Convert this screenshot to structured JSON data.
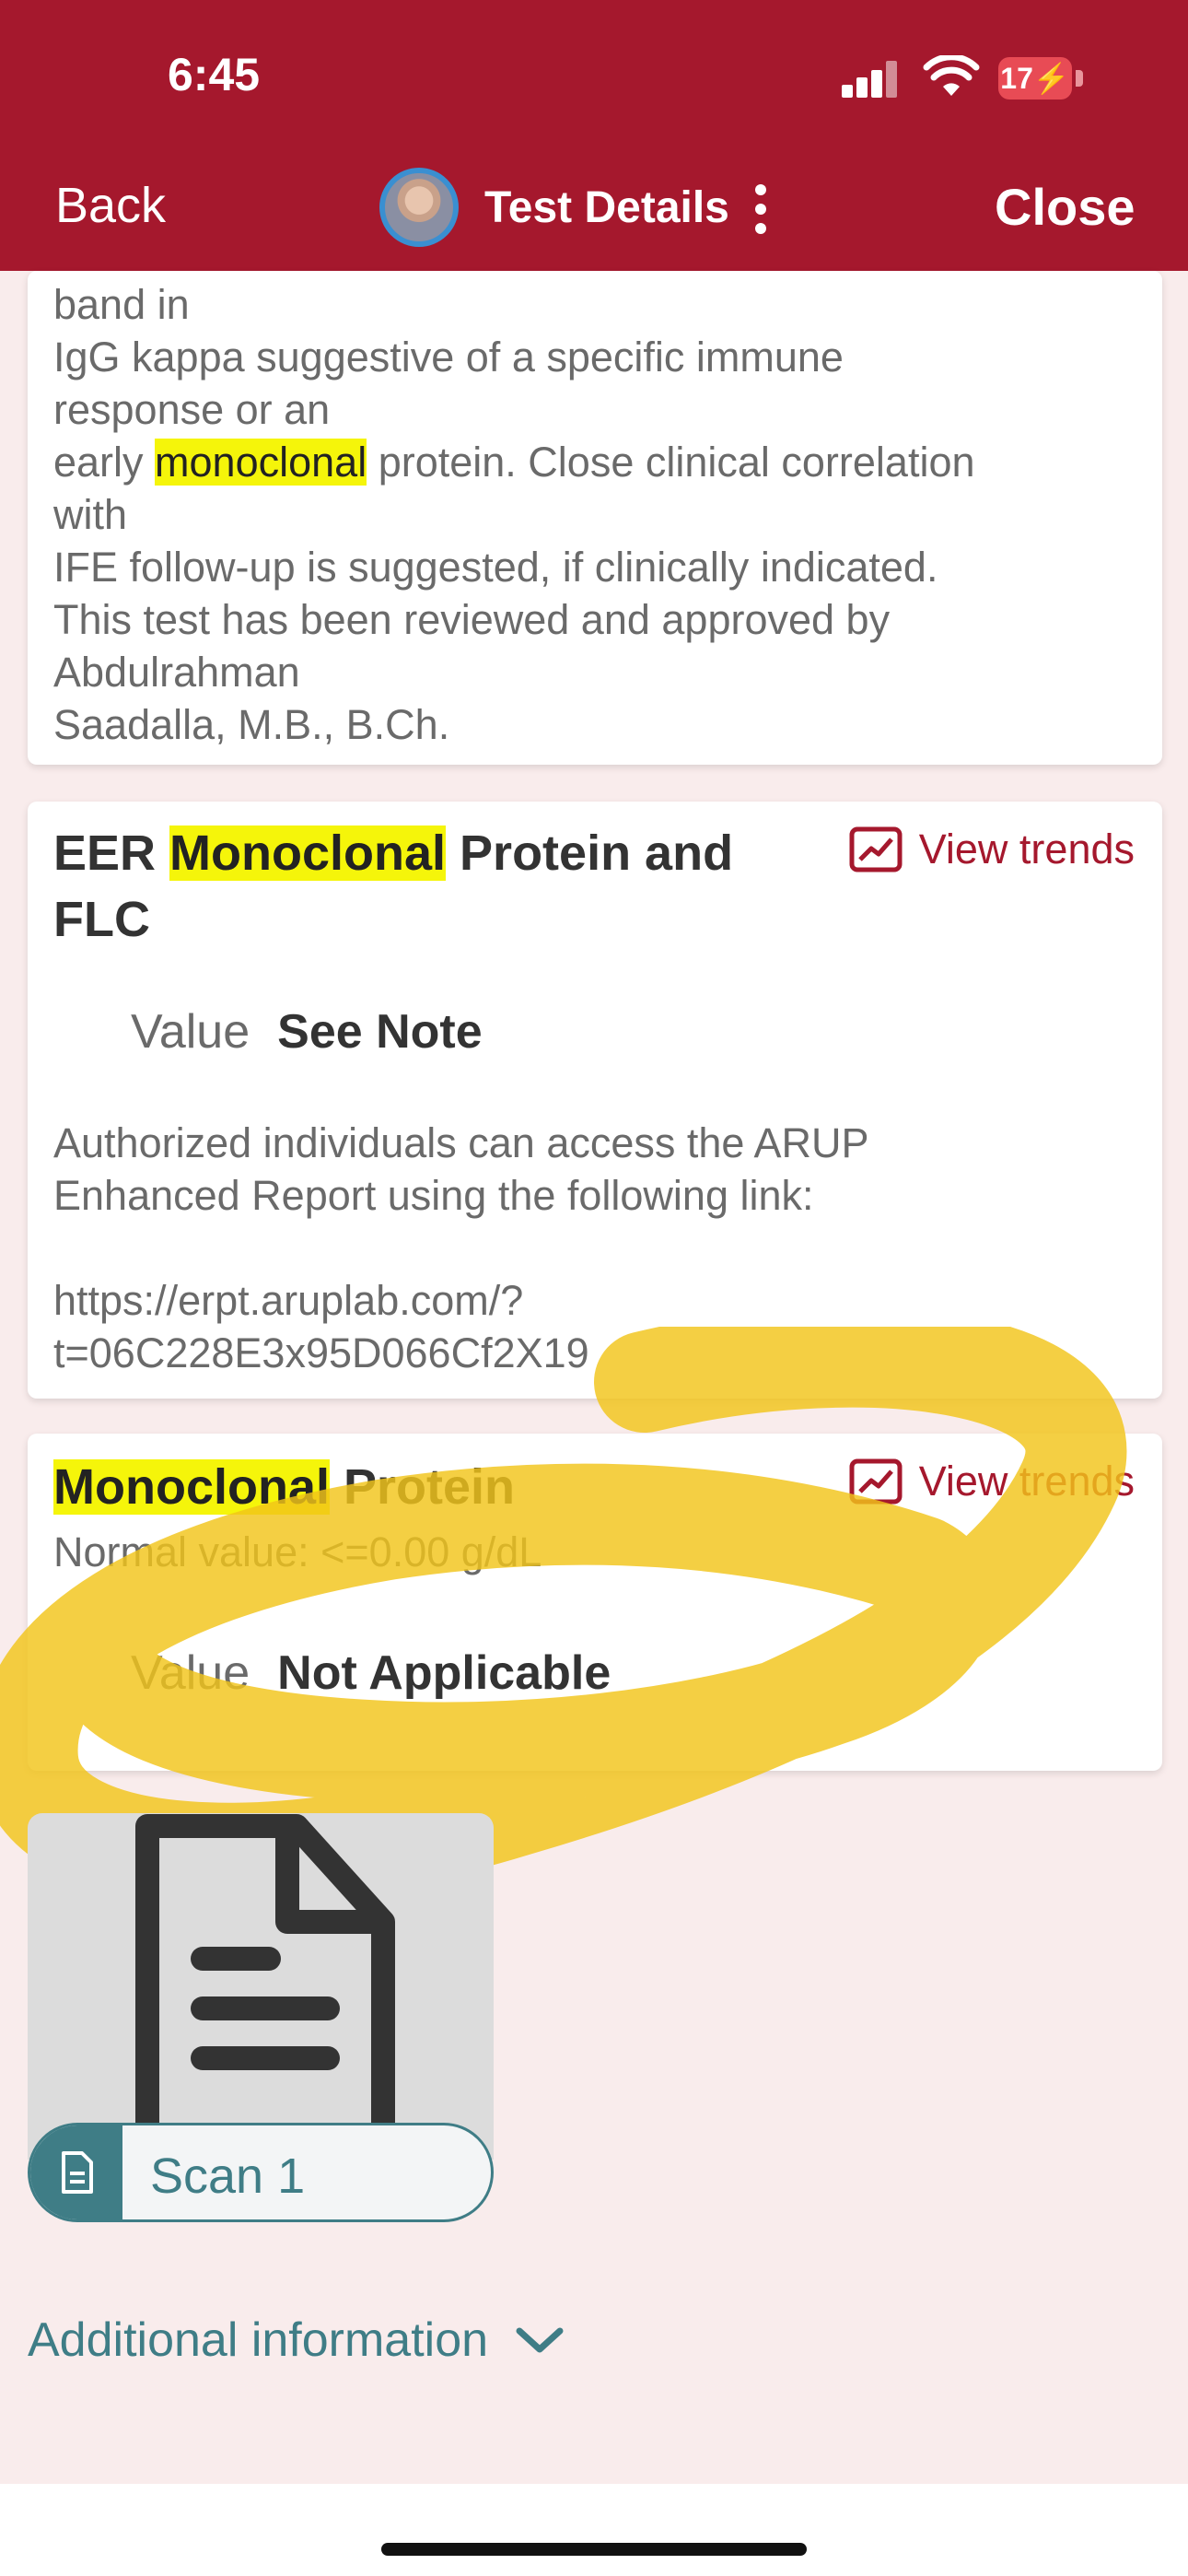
{
  "status_bar": {
    "time": "6:45",
    "battery": "17"
  },
  "nav": {
    "back": "Back",
    "title": "Test Details",
    "close": "Close"
  },
  "note_card": {
    "lines": [
      "band in",
      "IgG kappa suggestive of a specific immune",
      "response or an",
      "early ",
      "monoclonal",
      " protein. Close clinical correlation",
      "with",
      "IFE follow-up is suggested, if clinically indicated.",
      "This test has been reviewed and approved by",
      "Abdulrahman",
      "Saadalla, M.B., B.Ch."
    ]
  },
  "eer_card": {
    "title_pre": "EER ",
    "title_hl": "Monoclonal",
    "title_post": " Protein and FLC",
    "trends": "View trends",
    "value_label": "Value",
    "value": "See Note",
    "note_line1": "Authorized individuals can access the ARUP",
    "note_line2": "Enhanced Report using the following link:",
    "link_line1": "https://erpt.aruplab.com/?",
    "link_line2": "t=06C228E3x95D066Cf2X19"
  },
  "mono_card": {
    "title_hl": "Monoclonal",
    "title_post": " Protein",
    "trends": "View trends",
    "normal": "Normal value: <=0.00 g/dL",
    "value_label": "Value",
    "value": "Not Applicable"
  },
  "scan": {
    "label": "Scan 1"
  },
  "additional": {
    "label": "Additional information"
  },
  "colors": {
    "header": "#a5182d",
    "teal": "#3f7d86",
    "highlight": "#f5f50a",
    "marker": "#f2c51a"
  }
}
